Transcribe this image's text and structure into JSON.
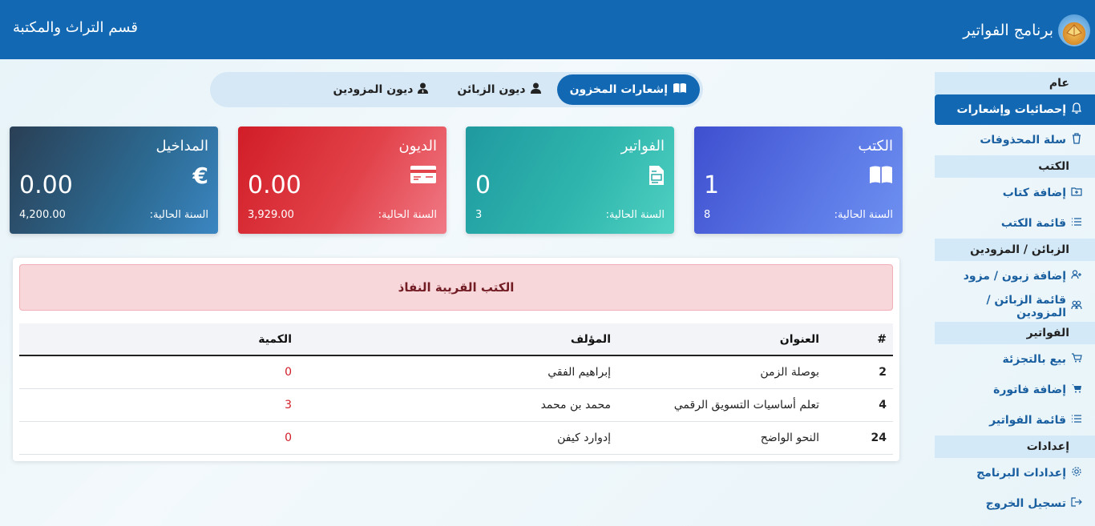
{
  "header": {
    "app_title": "برنامج الفواتير",
    "section_title": "قسم التراث والمكتبة"
  },
  "sidebar": {
    "groups": [
      {
        "label": "عام",
        "items": [
          {
            "label": "إحصائيات وإشعارات",
            "icon": "bell-icon",
            "active": true
          },
          {
            "label": "سلة المحذوفات",
            "icon": "trash-icon"
          }
        ]
      },
      {
        "label": "الكتب",
        "items": [
          {
            "label": "إضافة كتاب",
            "icon": "folder-plus-icon"
          },
          {
            "label": "قائمة الكتب",
            "icon": "list-icon"
          }
        ]
      },
      {
        "label": "الزبائن / المزودين",
        "items": [
          {
            "label": "إضافة زبون / مزود",
            "icon": "user-plus-icon"
          },
          {
            "label": "قائمة الزبائن / المزودين",
            "icon": "users-icon"
          }
        ]
      },
      {
        "label": "الفواتير",
        "items": [
          {
            "label": "بيع بالتجزئة",
            "icon": "cart-icon"
          },
          {
            "label": "إضافة فاتورة",
            "icon": "cart-plus-icon"
          },
          {
            "label": "قائمة الفواتير",
            "icon": "list-icon"
          }
        ]
      },
      {
        "label": "إعدادات",
        "items": [
          {
            "label": "إعدادات البرنامج",
            "icon": "gear-icon"
          },
          {
            "label": "تسجيل الخروج",
            "icon": "logout-icon"
          }
        ]
      }
    ]
  },
  "tabs": [
    {
      "label": "إشعارات المخزون",
      "icon": "book-open-icon",
      "active": true
    },
    {
      "label": "ديون الزبائن",
      "icon": "user-icon"
    },
    {
      "label": "ديون المزودين",
      "icon": "user-tie-icon"
    }
  ],
  "cards": {
    "books": {
      "title": "الكتب",
      "value": "1",
      "label": "السنة الحالية:",
      "sub": "8"
    },
    "invoices": {
      "title": "الفواتير",
      "value": "0",
      "label": "السنة الحالية:",
      "sub": "3"
    },
    "debts": {
      "title": "الديون",
      "value": "0.00",
      "label": "السنة الحالية:",
      "sub": "3,929.00"
    },
    "income": {
      "title": "المداخيل",
      "value": "0.00",
      "label": "السنة الحالية:",
      "sub": "4,200.00"
    }
  },
  "stock_alert": {
    "title": "الكتب القريبة النفاذ",
    "columns": {
      "num": "#",
      "title": "العنوان",
      "author": "المؤلف",
      "qty": "الكمية"
    },
    "rows": [
      {
        "num": "2",
        "title": "بوصلة الزمن",
        "author": "إبراهيم الفقي",
        "qty": "0"
      },
      {
        "num": "4",
        "title": "تعلم أساسيات التسويق الرقمي",
        "author": "محمد بن محمد",
        "qty": "3"
      },
      {
        "num": "24",
        "title": "النحو الواضح",
        "author": "إدوارد كيفن",
        "qty": "0"
      }
    ]
  },
  "colors": {
    "primary": "#1268b3",
    "danger": "#d11d27"
  }
}
